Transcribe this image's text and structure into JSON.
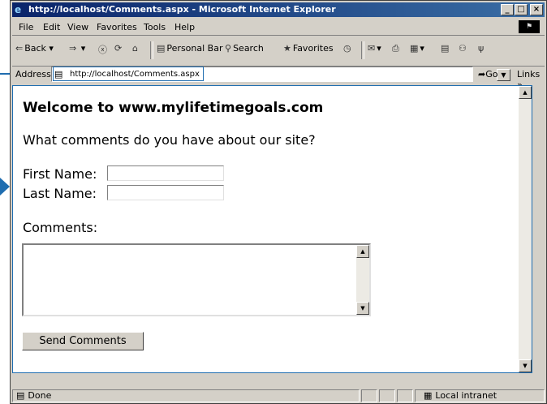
{
  "window": {
    "title": "http://localhost/Comments.aspx - Microsoft Internet Explorer",
    "min": "_",
    "max": "□",
    "close": "×"
  },
  "menu": [
    "File",
    "Edit",
    "View",
    "Favorites",
    "Tools",
    "Help"
  ],
  "toolbar": {
    "back": "Back",
    "personal_bar": "Personal Bar",
    "search": "Search",
    "favorites": "Favorites"
  },
  "address": {
    "label": "Address",
    "url": "http://localhost/Comments.aspx",
    "go": "Go",
    "links": "Links »"
  },
  "page": {
    "heading": "Welcome to www.mylifetimegoals.com",
    "question": "What comments do you have about our site?",
    "first_name_label": "First Name:",
    "first_name_value": "",
    "last_name_label": "Last Name:",
    "last_name_value": "",
    "comments_label": "Comments:",
    "comments_value": "",
    "send_button": "Send Comments"
  },
  "status": {
    "text": "Done",
    "zone": "Local intranet"
  },
  "colors": {
    "callout": "#1f6db0",
    "titlebar": "#0a246a",
    "chrome": "#d4d0c8"
  }
}
